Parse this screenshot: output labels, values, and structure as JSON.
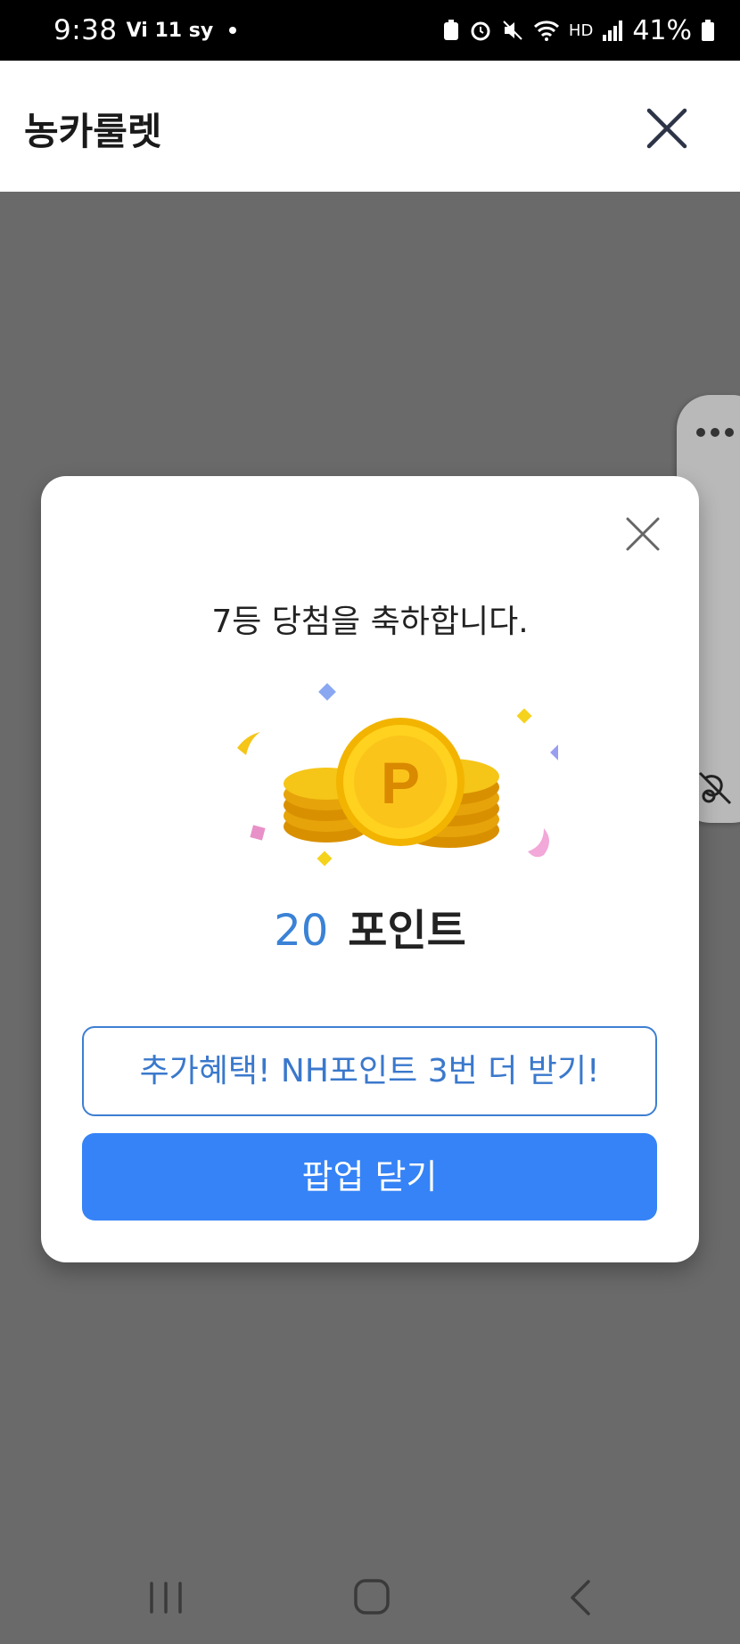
{
  "status_bar": {
    "time": "9:38",
    "left_icons_text": "Vi 11 sy",
    "wifi_label": "HD",
    "battery": "41%"
  },
  "header": {
    "title": "농카룰렛"
  },
  "popup": {
    "title": "7등 당첨을 축하합니다.",
    "points_value": "20",
    "points_unit": "포인트",
    "coin_letter": "P",
    "extra_button_label": "추가혜택! NH포인트 3번 더 받기!",
    "close_button_label": "팝업 닫기"
  },
  "colors": {
    "accent_blue": "#3583f6",
    "text_blue": "#3a78cc",
    "coin_gold": "#f5c518",
    "overlay_gray": "#6a6a6a"
  }
}
